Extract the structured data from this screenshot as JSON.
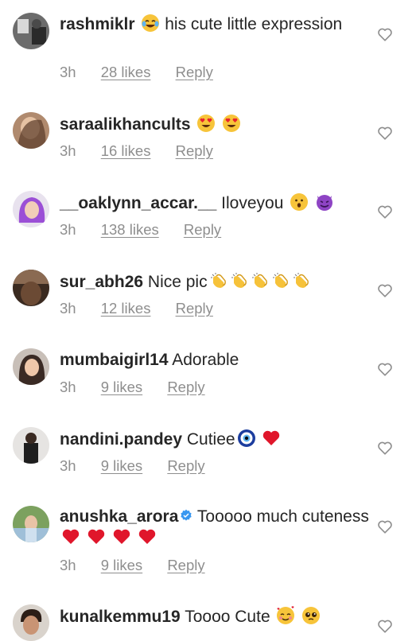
{
  "comments": [
    {
      "username": "rashmiklr",
      "text": "his cute little expression",
      "time": "3h",
      "likes": "28 likes",
      "reply": "Reply",
      "emojis_after_user": [
        "face-with-tears-of-joy"
      ],
      "emojis": []
    },
    {
      "username": "saraalikhancults",
      "text": "",
      "time": "3h",
      "likes": "16 likes",
      "reply": "Reply",
      "emojis": [
        "smiling-face-with-heart-eyes",
        "smiling-face-with-heart-eyes"
      ]
    },
    {
      "username": "__oaklynn_accar.__",
      "text": "Iloveyou",
      "time": "3h",
      "likes": "138 likes",
      "reply": "Reply",
      "emojis": [
        "hushed-face",
        "smiling-face-with-horns"
      ]
    },
    {
      "username": "sur_abh26",
      "text": "Nice pic",
      "time": "3h",
      "likes": "12 likes",
      "reply": "Reply",
      "emojis": [
        "clapping-hands",
        "clapping-hands",
        "clapping-hands",
        "clapping-hands",
        "clapping-hands"
      ]
    },
    {
      "username": "mumbaigirl14",
      "text": "Adorable",
      "time": "3h",
      "likes": "9 likes",
      "reply": "Reply",
      "emojis": []
    },
    {
      "username": "nandini.pandey",
      "text": "Cutiee",
      "time": "3h",
      "likes": "9 likes",
      "reply": "Reply",
      "emojis": [
        "nazar-amulet",
        "red-heart"
      ]
    },
    {
      "username": "anushka_arora",
      "text": "Tooooo much cuteness",
      "time": "3h",
      "likes": "9 likes",
      "reply": "Reply",
      "verified": true,
      "emojis": [
        "red-heart",
        "red-heart",
        "red-heart",
        "red-heart"
      ]
    },
    {
      "username": "kunalkemmu19",
      "text": "Toooo Cute",
      "time": "",
      "likes": "",
      "reply": "",
      "emojis": [
        "smiling-face-with-hearts",
        "pleading-face"
      ]
    }
  ],
  "icons": {
    "like": "heart-outline-icon",
    "verified": "verified-badge-icon"
  },
  "colors": {
    "text": "#262626",
    "meta": "#8e8e8e",
    "verified": "#3897f0",
    "heart_red": "#e0162b"
  }
}
